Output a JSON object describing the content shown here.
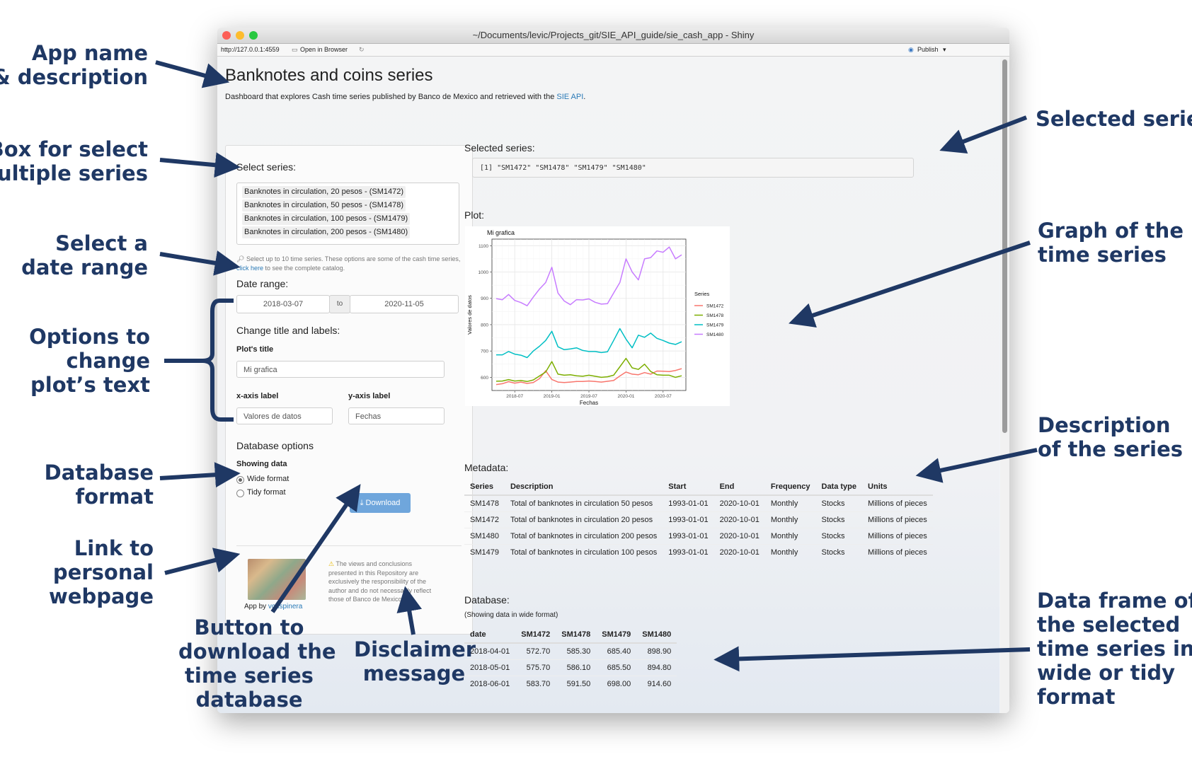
{
  "annotations": {
    "app_name": [
      "App name",
      "& description"
    ],
    "box_select": [
      "Box for select",
      "multiple series"
    ],
    "date_range": [
      "Select a",
      "date range"
    ],
    "options_text": [
      "Options to",
      "change",
      "plot’s text"
    ],
    "db_format": [
      "Database",
      "format"
    ],
    "link_web": [
      "Link to",
      "personal",
      "webpage"
    ],
    "button_dl": [
      "Button to",
      "download the",
      "time series",
      "database"
    ],
    "disclaimer": [
      "Disclaimer",
      "message"
    ],
    "selected_series": [
      "Selected series"
    ],
    "graph": [
      "Graph of the",
      "time series"
    ],
    "description": [
      "Description",
      "of the series"
    ],
    "data_frame": [
      "Data frame of",
      "the selected",
      "time series in",
      "wide or tidy",
      "format"
    ]
  },
  "window": {
    "title": "~/Documents/levic/Projects_git/SIE_API_guide/sie_cash_app - Shiny",
    "url": "http://127.0.0.1:4559",
    "open_browser": "Open in Browser",
    "publish": "Publish"
  },
  "app": {
    "title": "Banknotes and coins series",
    "subtitle": "Dashboard that explores Cash time series published by Banco de Mexico and retrieved with the",
    "subtitle_link": "SIE API",
    "subtitle_end": "."
  },
  "sidebar": {
    "select_label": "Select series:",
    "series": [
      "Banknotes in circulation, 20 pesos - (SM1472)",
      "Banknotes in circulation, 50 pesos - (SM1478)",
      "Banknotes in circulation, 100 pesos - (SM1479)",
      "Banknotes in circulation, 200 pesos - (SM1480)"
    ],
    "help_1": "Select up to 10 time series. These options are some of the cash time series,",
    "help_link": "click here",
    "help_2": "to see the complete catalog.",
    "date_label": "Date range:",
    "date_start": "2018-03-07",
    "date_to": "to",
    "date_end": "2020-11-05",
    "change_label": "Change title and labels:",
    "plot_title_label": "Plot's title",
    "plot_title_value": "Mi grafica",
    "x_label": "x-axis label",
    "x_value": "Valores de datos",
    "y_label": "y-axis label",
    "y_value": "Fechas",
    "db_options": "Database options",
    "showing": "Showing data",
    "wide": "Wide format",
    "tidy": "Tidy format",
    "download": "Download",
    "app_by": "App by",
    "author": "vcuspinera",
    "disclaimer": "The views and conclusions presented in this Repository are exclusively the responsibility of the author and do not necessarily reflect those of Banco de Mexico."
  },
  "main": {
    "selected_label": "Selected series:",
    "selected_value": "[1] \"SM1472\" \"SM1478\" \"SM1479\" \"SM1480\"",
    "plot_label": "Plot:",
    "metadata_label": "Metadata:",
    "metadata_headers": [
      "Series",
      "Description",
      "Start",
      "End",
      "Frequency",
      "Data type",
      "Units"
    ],
    "metadata_rows": [
      [
        "SM1478",
        "Total of banknotes in circulation 50 pesos",
        "1993-01-01",
        "2020-10-01",
        "Monthly",
        "Stocks",
        "Millions of pieces"
      ],
      [
        "SM1472",
        "Total of banknotes in circulation 20 pesos",
        "1993-01-01",
        "2020-10-01",
        "Monthly",
        "Stocks",
        "Millions of pieces"
      ],
      [
        "SM1480",
        "Total of banknotes in circulation 200 pesos",
        "1993-01-01",
        "2020-10-01",
        "Monthly",
        "Stocks",
        "Millions of pieces"
      ],
      [
        "SM1479",
        "Total of banknotes in circulation 100 pesos",
        "1993-01-01",
        "2020-10-01",
        "Monthly",
        "Stocks",
        "Millions of pieces"
      ]
    ],
    "database_label": "Database:",
    "database_note": "(Showing data in wide format)",
    "db_headers": [
      "date",
      "SM1472",
      "SM1478",
      "SM1479",
      "SM1480"
    ],
    "db_rows": [
      [
        "2018-04-01",
        "572.70",
        "585.30",
        "685.40",
        "898.90"
      ],
      [
        "2018-05-01",
        "575.70",
        "586.10",
        "685.50",
        "894.80"
      ],
      [
        "2018-06-01",
        "583.70",
        "591.50",
        "698.00",
        "914.60"
      ]
    ]
  },
  "chart_data": {
    "type": "line",
    "title": "Mi grafica",
    "xlabel": "Fechas",
    "ylabel": "Valores de datos",
    "ylim": [
      550,
      1125
    ],
    "yticks": [
      600,
      700,
      800,
      900,
      1000,
      1100
    ],
    "xticks": [
      "2018-07",
      "2019-01",
      "2019-07",
      "2020-01",
      "2020-07"
    ],
    "x": [
      "2018-04",
      "2018-05",
      "2018-06",
      "2018-07",
      "2018-08",
      "2018-09",
      "2018-10",
      "2018-11",
      "2018-12",
      "2019-01",
      "2019-02",
      "2019-03",
      "2019-04",
      "2019-05",
      "2019-06",
      "2019-07",
      "2019-08",
      "2019-09",
      "2019-10",
      "2019-11",
      "2019-12",
      "2020-01",
      "2020-02",
      "2020-03",
      "2020-04",
      "2020-05",
      "2020-06",
      "2020-07",
      "2020-08",
      "2020-09",
      "2020-10"
    ],
    "legend_title": "Series",
    "legend_position": "right",
    "series": [
      {
        "name": "SM1472",
        "color": "#f8766d",
        "values": [
          572.7,
          575.7,
          583.7,
          578,
          582,
          577,
          580,
          595,
          625,
          592,
          582,
          580,
          582,
          584,
          584,
          586,
          584,
          582,
          585,
          588,
          605,
          620,
          612,
          610,
          618,
          612,
          624,
          623,
          622,
          626,
          633
        ]
      },
      {
        "name": "SM1478",
        "color": "#7cae00",
        "values": [
          585.3,
          586.1,
          591.5,
          586,
          588,
          584,
          590,
          605,
          620,
          660,
          612,
          608,
          610,
          606,
          604,
          608,
          604,
          600,
          602,
          608,
          640,
          672,
          636,
          630,
          650,
          622,
          610,
          608,
          608,
          600,
          606
        ]
      },
      {
        "name": "SM1479",
        "color": "#00bfc4",
        "values": [
          685.4,
          685.5,
          698,
          688,
          684,
          675,
          700,
          718,
          740,
          775,
          716,
          705,
          708,
          712,
          702,
          698,
          698,
          694,
          697,
          740,
          785,
          745,
          712,
          760,
          752,
          768,
          748,
          740,
          730,
          725,
          735
        ]
      },
      {
        "name": "SM1480",
        "color": "#c77cff",
        "values": [
          898.9,
          894.8,
          914.6,
          892,
          884,
          872,
          905,
          935,
          960,
          1018,
          920,
          890,
          876,
          895,
          894,
          898,
          885,
          878,
          880,
          920,
          960,
          1050,
          1000,
          970,
          1050,
          1055,
          1080,
          1075,
          1095,
          1050,
          1065
        ]
      }
    ]
  }
}
